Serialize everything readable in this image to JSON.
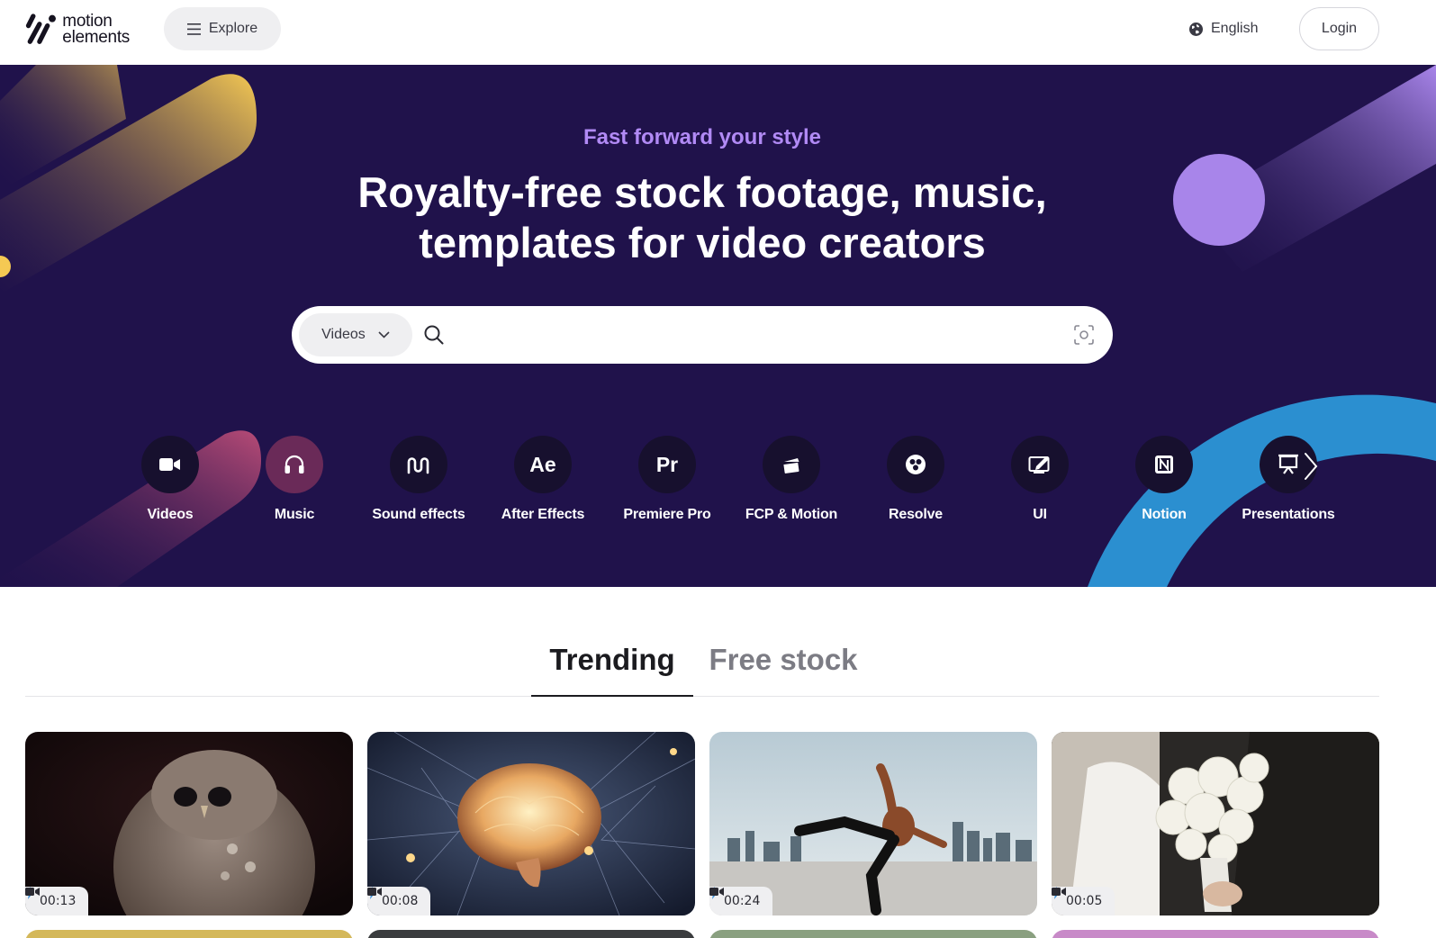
{
  "header": {
    "logo_line1": "motion",
    "logo_line2": "elements",
    "explore_label": "Explore",
    "language_label": "English",
    "login_label": "Login"
  },
  "hero": {
    "tagline": "Fast forward your style",
    "headline_line1": "Royalty-free stock footage, music,",
    "headline_line2": "templates for video creators",
    "search": {
      "type_selected": "Videos",
      "placeholder": ""
    },
    "categories": [
      {
        "label": "Videos",
        "icon": "video-camera-icon"
      },
      {
        "label": "Music",
        "icon": "headphones-icon"
      },
      {
        "label": "Sound effects",
        "icon": "sound-wave-icon"
      },
      {
        "label": "After Effects",
        "icon": "after-effects-icon",
        "glyph": "Ae"
      },
      {
        "label": "Premiere Pro",
        "icon": "premiere-pro-icon",
        "glyph": "Pr"
      },
      {
        "label": "FCP & Motion",
        "icon": "clapperboard-icon"
      },
      {
        "label": "Resolve",
        "icon": "resolve-icon"
      },
      {
        "label": "UI",
        "icon": "ui-design-icon"
      },
      {
        "label": "Notion",
        "icon": "notion-icon"
      },
      {
        "label": "Presentations",
        "icon": "presentation-icon"
      }
    ]
  },
  "tabs": [
    {
      "label": "Trending",
      "active": true
    },
    {
      "label": "Free stock",
      "active": false
    }
  ],
  "cards": [
    {
      "duration": "00:13",
      "subject": "owl"
    },
    {
      "duration": "00:08",
      "subject": "glowing brain"
    },
    {
      "duration": "00:24",
      "subject": "dancer on rooftop"
    },
    {
      "duration": "00:05",
      "subject": "bridal bouquet"
    }
  ],
  "colors": {
    "hero_bg": "#20124b",
    "tagline": "#b18af5",
    "accent_yellow": "#f5c953",
    "accent_purple": "#b18af5",
    "accent_blue": "#2b8fd0"
  }
}
